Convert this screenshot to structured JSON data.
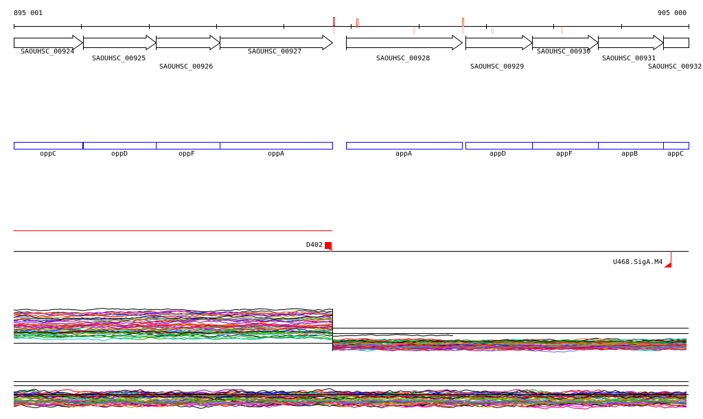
{
  "ruler": {
    "start_label": "895 001",
    "end_label": "905 000"
  },
  "genes": [
    {
      "id": "SAOUHSC_00924",
      "name": "oppC"
    },
    {
      "id": "SAOUHSC_00925",
      "name": "oppD"
    },
    {
      "id": "SAOUHSC_00926",
      "name": "oppF"
    },
    {
      "id": "SAOUHSC_00927",
      "name": "oppA"
    },
    {
      "id": "SAOUHSC_00928",
      "name": "appA"
    },
    {
      "id": "SAOUHSC_00929",
      "name": "appD"
    },
    {
      "id": "SAOUHSC_00930",
      "name": "appF"
    },
    {
      "id": "SAOUHSC_00931",
      "name": "appB"
    },
    {
      "id": "SAOUHSC_00932",
      "name": "appC"
    }
  ],
  "features": {
    "segment_label": "D402",
    "promoter_label": "U468.SigA.M4"
  },
  "colors": {
    "gene_box": "#0000ff",
    "feature": "#ff0000",
    "axis": "#000000",
    "trace_palette": [
      "#000000",
      "#ff0000",
      "#00aa00",
      "#0000ff",
      "#ff00ff",
      "#00cccc",
      "#cc8800",
      "#8800cc",
      "#888888",
      "#cc0044",
      "#44cc00",
      "#aa6633",
      "#ff8800",
      "#6666ff"
    ]
  }
}
